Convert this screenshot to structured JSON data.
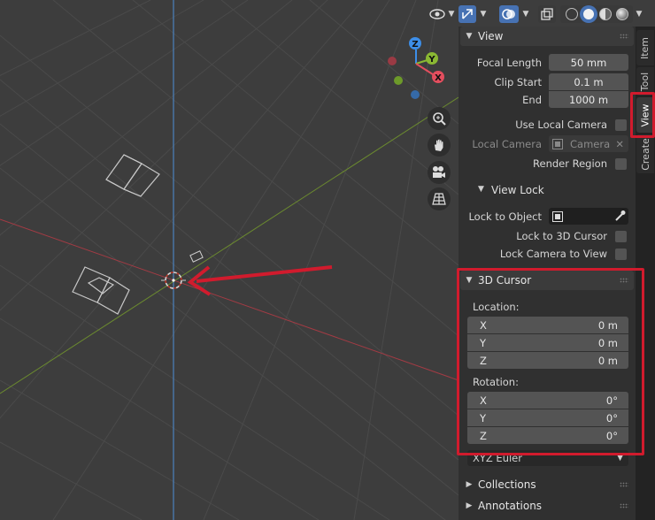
{
  "sidebar_tabs": [
    "Item",
    "Tool",
    "View",
    "Create"
  ],
  "view_panel": {
    "title": "View",
    "focal_length": {
      "label": "Focal Length",
      "value": "50 mm"
    },
    "clip_start": {
      "label": "Clip Start",
      "value": "0.1 m"
    },
    "clip_end": {
      "label": "End",
      "value": "1000 m"
    },
    "use_local_camera": "Use Local Camera",
    "local_camera": {
      "label": "Local Camera",
      "value": "Camera"
    },
    "render_region": "Render Region"
  },
  "view_lock": {
    "title": "View Lock",
    "lock_to_object": "Lock to Object",
    "lock_to_3d_cursor": "Lock to 3D Cursor",
    "lock_camera_to_view": "Lock Camera to View"
  },
  "cursor_panel": {
    "title": "3D Cursor",
    "location_label": "Location:",
    "location": [
      {
        "axis": "X",
        "value": "0 m"
      },
      {
        "axis": "Y",
        "value": "0 m"
      },
      {
        "axis": "Z",
        "value": "0 m"
      }
    ],
    "rotation_label": "Rotation:",
    "rotation": [
      {
        "axis": "X",
        "value": "0°"
      },
      {
        "axis": "Y",
        "value": "0°"
      },
      {
        "axis": "Z",
        "value": "0°"
      }
    ],
    "rotation_mode": "XYZ Euler"
  },
  "collapsed_panels": [
    "Collections",
    "Annotations"
  ],
  "gizmo_axes": [
    "Z",
    "Y",
    "X"
  ],
  "colors": {
    "highlight": "#d11b2d",
    "axis_x": "#e34e5e",
    "axis_y": "#8ab833",
    "axis_z": "#3d8ee8",
    "accent_blue": "#4772b3"
  },
  "icons": {
    "viewport_header": [
      "visibility-eye-icon",
      "gizmo-toggle-icon",
      "overlay-icon",
      "xray-icon",
      "wireframe-shading-icon",
      "solid-shading-icon",
      "material-shading-icon",
      "rendered-shading-icon"
    ],
    "navigation": [
      "zoom-icon",
      "pan-hand-icon",
      "camera-view-icon",
      "perspective-grid-icon"
    ]
  }
}
